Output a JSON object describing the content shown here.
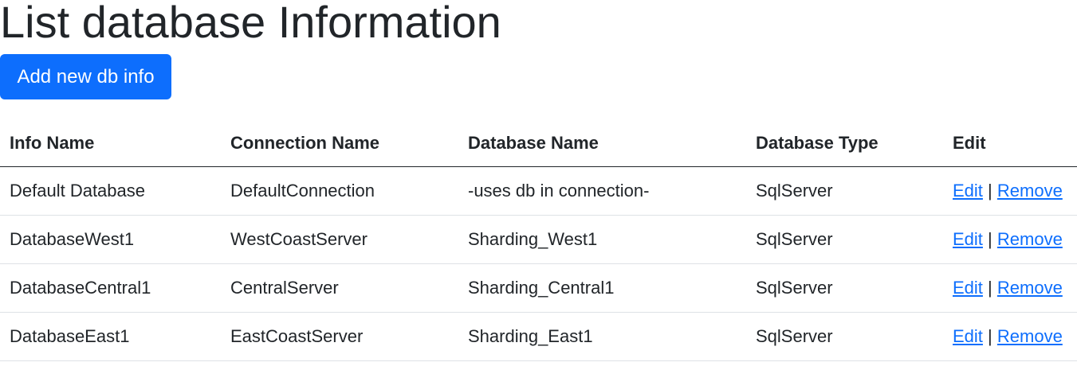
{
  "page": {
    "title": "List database Information"
  },
  "toolbar": {
    "add_label": "Add new db info"
  },
  "table": {
    "headers": [
      "Info Name",
      "Connection Name",
      "Database Name",
      "Database Type",
      "Edit"
    ],
    "rows": [
      {
        "info_name": "Default Database",
        "connection_name": "DefaultConnection",
        "database_name": "-uses db in connection-",
        "database_type": "SqlServer",
        "edit_label": "Edit",
        "separator": "|",
        "remove_label": "Remove"
      },
      {
        "info_name": "DatabaseWest1",
        "connection_name": "WestCoastServer",
        "database_name": "Sharding_West1",
        "database_type": "SqlServer",
        "edit_label": "Edit",
        "separator": "|",
        "remove_label": "Remove"
      },
      {
        "info_name": "DatabaseCentral1",
        "connection_name": "CentralServer",
        "database_name": "Sharding_Central1",
        "database_type": "SqlServer",
        "edit_label": "Edit",
        "separator": "|",
        "remove_label": "Remove"
      },
      {
        "info_name": "DatabaseEast1",
        "connection_name": "EastCoastServer",
        "database_name": "Sharding_East1",
        "database_type": "SqlServer",
        "edit_label": "Edit",
        "separator": "|",
        "remove_label": "Remove"
      }
    ]
  },
  "colors": {
    "primary": "#0d6efd",
    "text": "#212529",
    "row_border": "#dee2e6"
  }
}
